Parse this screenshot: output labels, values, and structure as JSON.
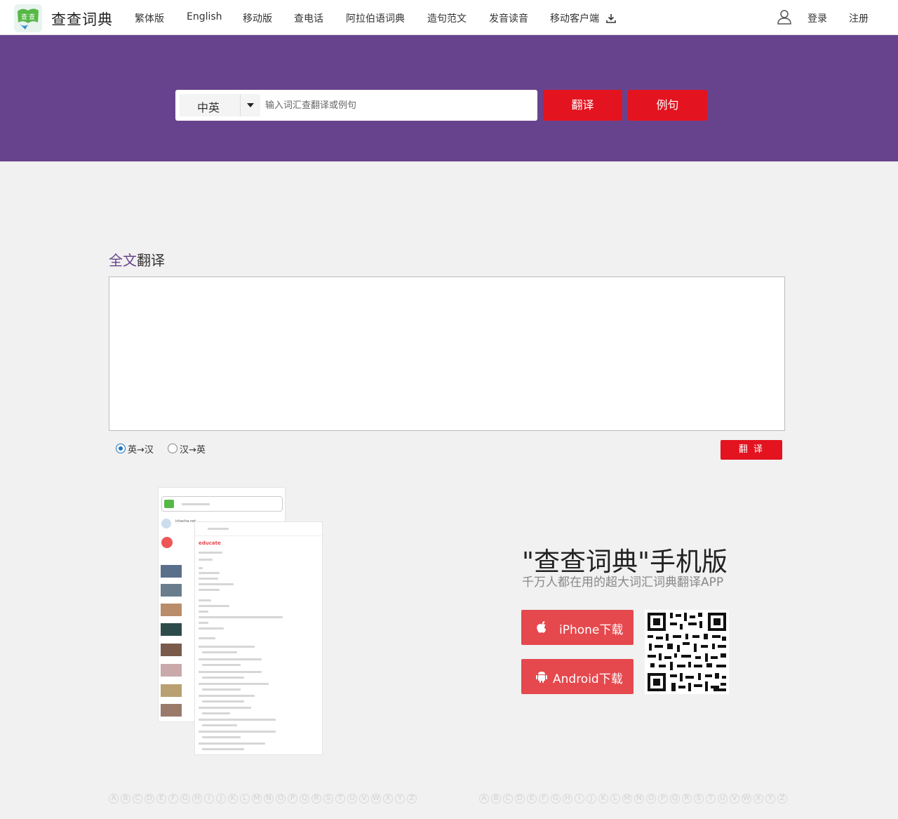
{
  "header": {
    "brand": "查查词典",
    "nav": [
      {
        "label": "繁体版"
      },
      {
        "label": "English"
      },
      {
        "label": "移动版"
      },
      {
        "label": "查电话"
      },
      {
        "label": "阿拉伯语词典"
      },
      {
        "label": "造句范文"
      },
      {
        "label": "发音读音"
      },
      {
        "label": "移动客户端"
      }
    ],
    "login": "登录",
    "register": "注册"
  },
  "search": {
    "lang": "中英",
    "placeholder": "输入词汇查翻译或例句",
    "translate_btn": "翻译",
    "example_btn": "例句"
  },
  "fulltext": {
    "title_accent": "全文",
    "title_rest": "翻译",
    "dir_en_zh": "英→汉",
    "dir_zh_en": "汉→英",
    "translate_btn": "翻 译"
  },
  "app": {
    "title": "\"查查词典\"手机版",
    "subtitle": "千万人都在用的超大词汇词典翻译APP",
    "iphone_btn": "iPhone下载",
    "android_btn": "Android下载",
    "shot_word": "educate",
    "shot_site": "ichacha.net"
  },
  "alphabet": [
    "A",
    "B",
    "C",
    "D",
    "E",
    "F",
    "G",
    "H",
    "I",
    "J",
    "K",
    "L",
    "M",
    "N",
    "O",
    "P",
    "Q",
    "R",
    "S",
    "T",
    "U",
    "V",
    "W",
    "X",
    "Y",
    "Z"
  ],
  "colors": {
    "purple": "#68438d",
    "red": "#e3131f",
    "app_red": "#e5484d",
    "background": "#f1f1f1"
  },
  "icons": [
    "logo-icon",
    "user-icon",
    "download-icon",
    "apple-icon",
    "android-icon",
    "qr-code"
  ]
}
